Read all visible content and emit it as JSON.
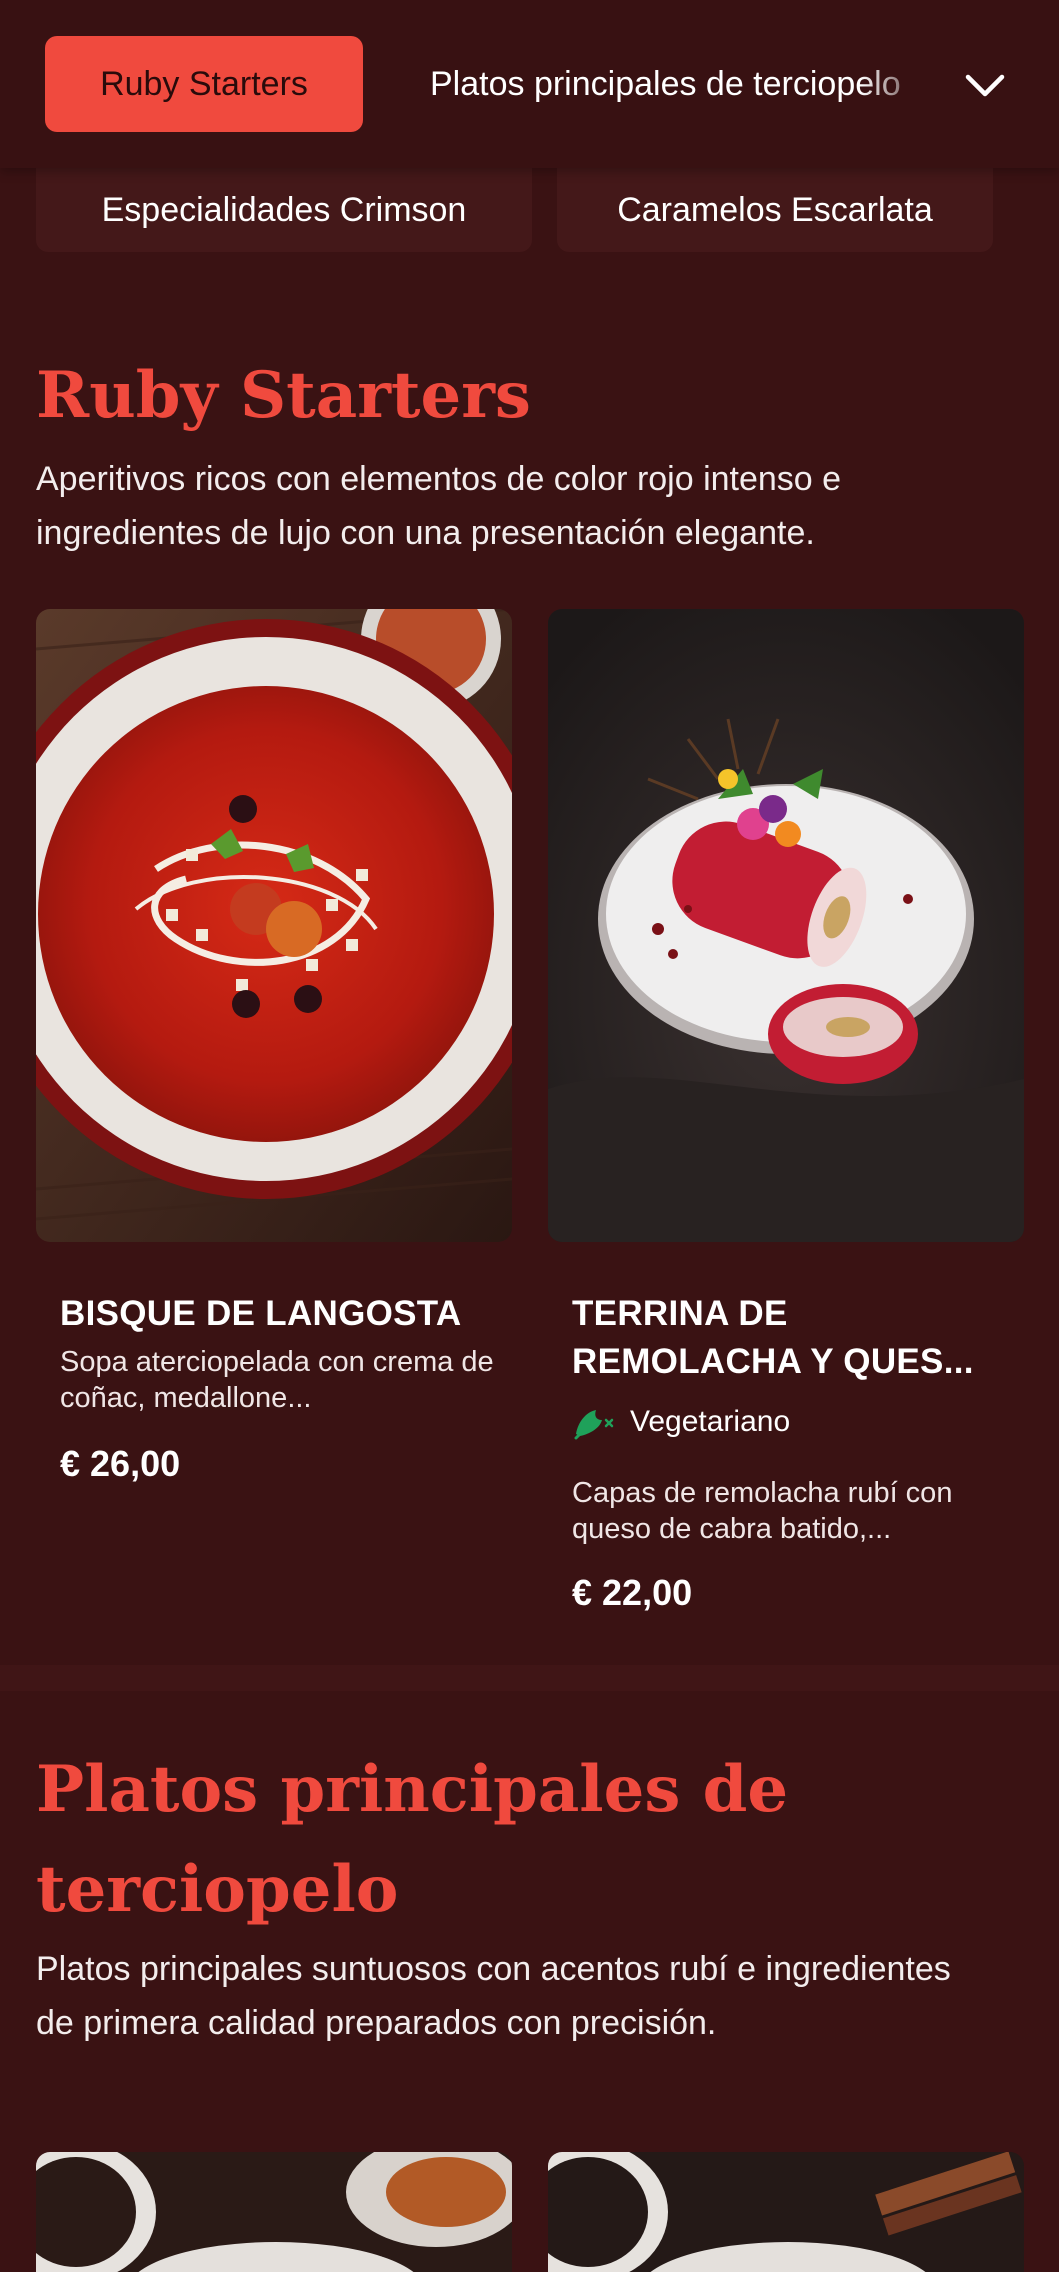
{
  "nav": {
    "active_tab": "Ruby Starters",
    "next_tab": "Platos principales de terciopelo",
    "chips": [
      "Especialidades Crimson",
      "Caramelos Escarlata"
    ]
  },
  "sections": [
    {
      "title": "Ruby Starters",
      "description": "Aperitivos ricos con elementos de color rojo intenso e ingredientes de lujo con una presentación elegante.",
      "items": [
        {
          "name": "BISQUE DE LANGOSTA",
          "description": "Sopa aterciopelada con crema de coñac, medallone...",
          "price": "€ 26,00"
        },
        {
          "name": "TERRINA DE REMOLACHA Y QUES...",
          "tag": "Vegetariano",
          "description": "Capas de remolacha rubí con queso de cabra batido,...",
          "price": "€ 22,00"
        }
      ]
    },
    {
      "title": "Platos principales de terciopelo",
      "description": "Platos principales suntuosos con acentos rubí e ingredientes de primera calidad preparados con precisión."
    }
  ],
  "colors": {
    "background": "#3a1213",
    "accent": "#f04a3e",
    "veg_icon": "#1fa15a"
  }
}
